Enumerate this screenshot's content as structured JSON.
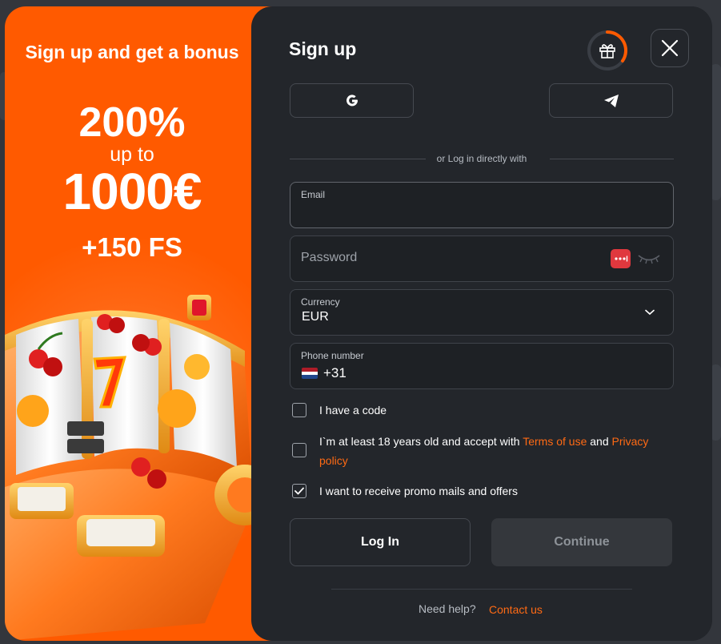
{
  "promo": {
    "title": "Sign up and get a bonus",
    "percent": "200%",
    "up_to": "up to",
    "amount": "1000€",
    "free_spins": "+150 FS"
  },
  "form": {
    "title": "Sign up",
    "divider_text": "or Log in directly with",
    "email": {
      "label": "Email",
      "value": ""
    },
    "password": {
      "placeholder": "Password"
    },
    "currency": {
      "label": "Currency",
      "value": "EUR"
    },
    "phone": {
      "label": "Phone number",
      "code": "+31"
    },
    "checks": [
      {
        "label": "I have a code",
        "checked": false
      },
      {
        "label_prefix": "I`m at least 18 years old and accept with ",
        "terms_link": "Terms of use",
        "and": " and ",
        "privacy_link": "Privacy policy",
        "checked": false
      },
      {
        "label": "I want to receive promo mails and offers",
        "checked": true
      }
    ],
    "login_button": "Log In",
    "continue_button": "Continue",
    "help_text": "Need help?",
    "help_link": "Contact us"
  },
  "colors": {
    "accent": "#ff5a00",
    "link": "#ff6a14",
    "panel": "#23262b"
  },
  "icons": [
    "gift-icon",
    "close-icon",
    "google-icon",
    "telegram-icon",
    "password-key-icon",
    "eye-closed-icon",
    "chevron-down-icon",
    "netherlands-flag-icon",
    "checkmark-icon"
  ]
}
